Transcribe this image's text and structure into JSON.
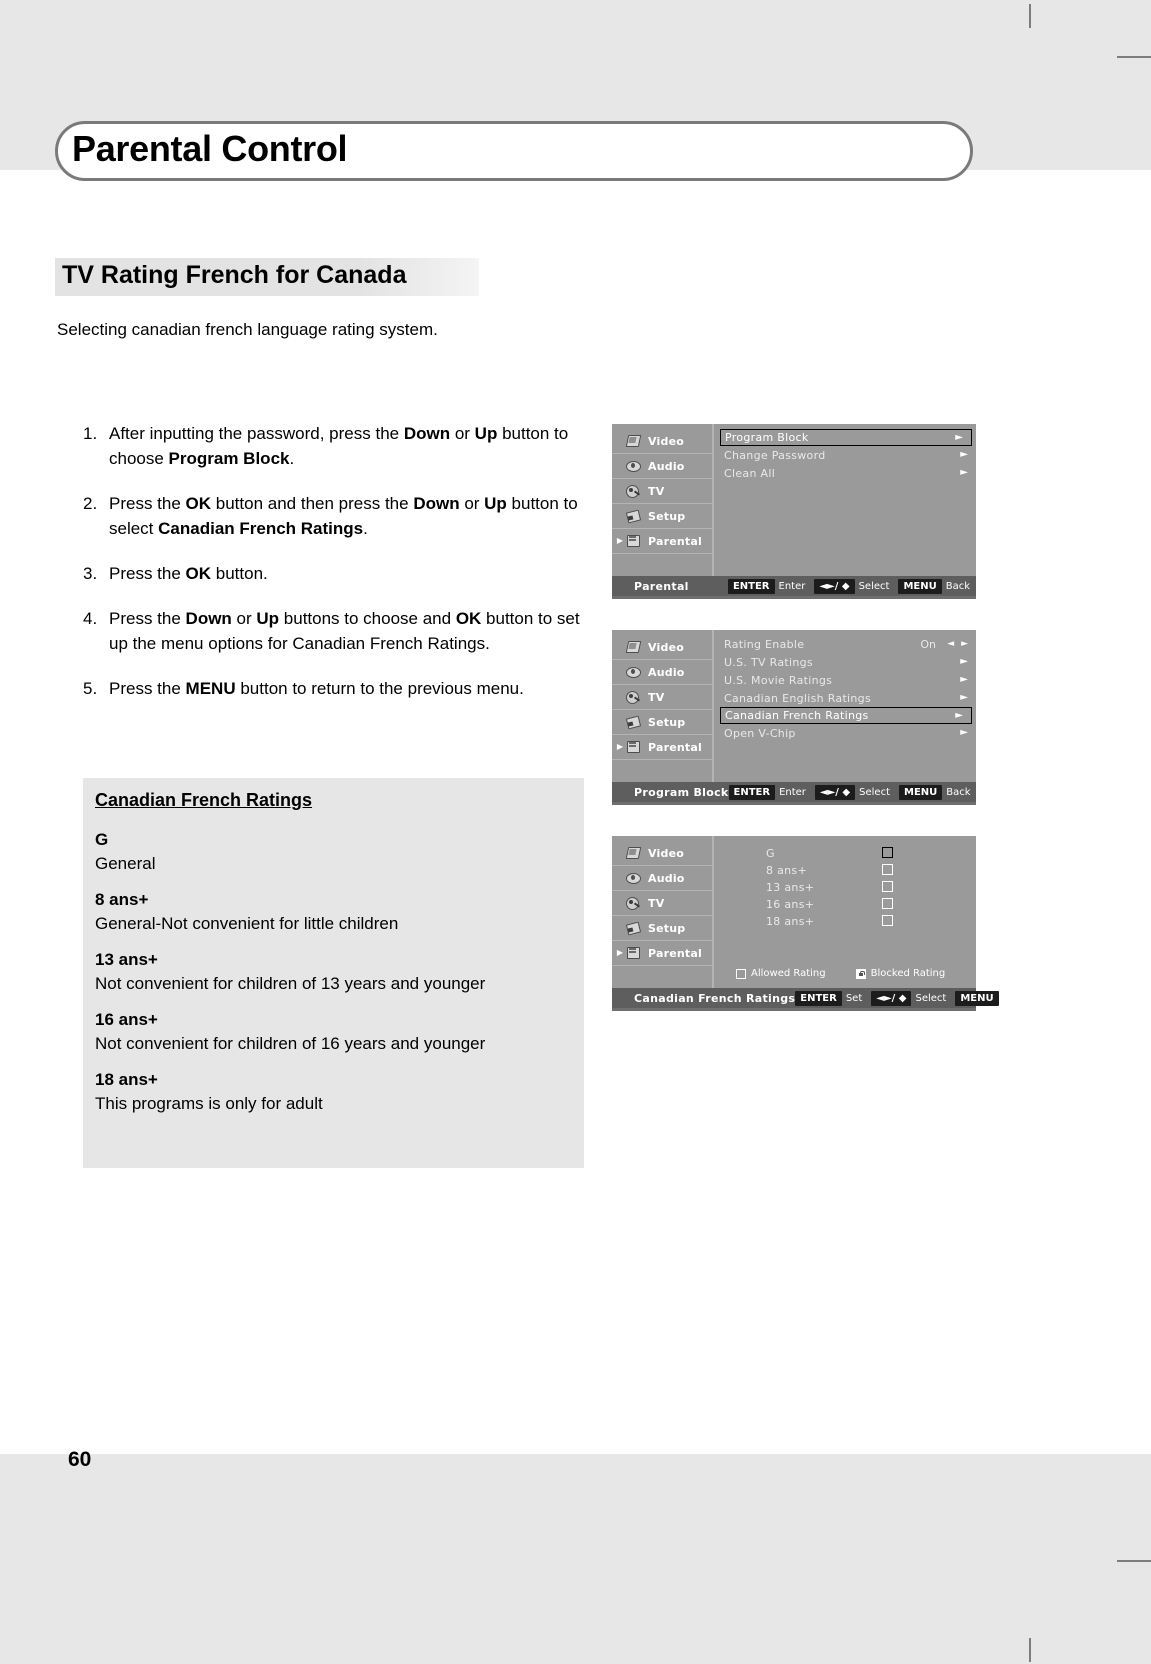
{
  "document": {
    "title": "Parental Control",
    "section_heading": "TV Rating French for Canada",
    "subtitle": "Selecting canadian french language rating system.",
    "page_number": "60"
  },
  "steps": [
    {
      "num": "1.",
      "parts": [
        {
          "t": "After inputting the password, press the ",
          "b": false
        },
        {
          "t": "Down",
          "b": true
        },
        {
          "t": " or ",
          "b": false
        },
        {
          "t": "Up",
          "b": true
        },
        {
          "t": " button to choose ",
          "b": false
        },
        {
          "t": "Program Block",
          "b": true
        },
        {
          "t": ".",
          "b": false
        }
      ]
    },
    {
      "num": "2.",
      "parts": [
        {
          "t": "Press the ",
          "b": false
        },
        {
          "t": "OK",
          "b": true
        },
        {
          "t": " button and then press the ",
          "b": false
        },
        {
          "t": "Down",
          "b": true
        },
        {
          "t": " or ",
          "b": false
        },
        {
          "t": "Up",
          "b": true
        },
        {
          "t": " button to select ",
          "b": false
        },
        {
          "t": "Canadian French Ratings",
          "b": true
        },
        {
          "t": ".",
          "b": false
        }
      ]
    },
    {
      "num": "3.",
      "parts": [
        {
          "t": "Press the ",
          "b": false
        },
        {
          "t": "OK",
          "b": true
        },
        {
          "t": " button.",
          "b": false
        }
      ]
    },
    {
      "num": "4.",
      "parts": [
        {
          "t": "Press the ",
          "b": false
        },
        {
          "t": "Down",
          "b": true
        },
        {
          "t": " or ",
          "b": false
        },
        {
          "t": "Up",
          "b": true
        },
        {
          "t": " buttons to choose and ",
          "b": false
        },
        {
          "t": "OK",
          "b": true
        },
        {
          "t": " button to set up the menu options for Canadian French Ratings.",
          "b": false
        }
      ]
    },
    {
      "num": "5.",
      "parts": [
        {
          "t": "Press the ",
          "b": false
        },
        {
          "t": "MENU",
          "b": true
        },
        {
          "t": " button to return to the previous menu.",
          "b": false
        }
      ]
    }
  ],
  "infobox": {
    "title": "Canadian French Ratings",
    "ratings": [
      {
        "code": "G",
        "desc": "General"
      },
      {
        "code": "8 ans+",
        "desc": "General-Not convenient for little children"
      },
      {
        "code": "13 ans+",
        "desc": "Not convenient for children of 13 years and younger"
      },
      {
        "code": "16 ans+",
        "desc": "Not convenient for children of 16 years and younger"
      },
      {
        "code": "18 ans+",
        "desc": "This programs is only for adult"
      }
    ]
  },
  "osd_nav": [
    {
      "label": "Video",
      "icon": "video-icon",
      "active": false
    },
    {
      "label": "Audio",
      "icon": "audio-icon",
      "active": false
    },
    {
      "label": "TV",
      "icon": "tv-icon",
      "active": false
    },
    {
      "label": "Setup",
      "icon": "setup-icon",
      "active": false
    },
    {
      "label": "Parental",
      "icon": "parental-icon",
      "active": true
    }
  ],
  "osd_footer_keys": {
    "enter_key": "ENTER",
    "enter_label": "Enter",
    "set_label": "Set",
    "dirs_key": "◄►/ ◆",
    "select_label": "Select",
    "menu_key": "MENU",
    "back_label": "Back"
  },
  "osd1": {
    "footer_title": "Parental",
    "enter_label": "Enter",
    "rows": [
      {
        "label": "Program Block",
        "selected": true,
        "arrow": "►"
      },
      {
        "label": "Change Password",
        "selected": false,
        "arrow": "►"
      },
      {
        "label": "Clean All",
        "selected": false,
        "arrow": "►"
      }
    ]
  },
  "osd2": {
    "footer_title": "Program Block",
    "enter_label": "Enter",
    "rows": [
      {
        "label": "Rating Enable",
        "selected": false,
        "value": "On",
        "lr": "◄ ►"
      },
      {
        "label": "U.S. TV Ratings",
        "selected": false,
        "arrow": "►"
      },
      {
        "label": "U.S. Movie Ratings",
        "selected": false,
        "arrow": "►"
      },
      {
        "label": "Canadian English Ratings",
        "selected": false,
        "arrow": "►"
      },
      {
        "label": "Canadian French Ratings",
        "selected": true,
        "arrow": "►"
      },
      {
        "label": "Open V-Chip",
        "selected": false,
        "arrow": "►"
      }
    ]
  },
  "osd3": {
    "footer_title": "Canadian French Ratings",
    "enter_label": "Set",
    "rows": [
      {
        "label": "G",
        "checked": false
      },
      {
        "label": "8 ans+",
        "checked": false
      },
      {
        "label": "13 ans+",
        "checked": false
      },
      {
        "label": "16 ans+",
        "checked": false
      },
      {
        "label": "18 ans+",
        "checked": false
      }
    ],
    "legend": {
      "allowed": "Allowed Rating",
      "blocked": "Blocked Rating"
    }
  }
}
